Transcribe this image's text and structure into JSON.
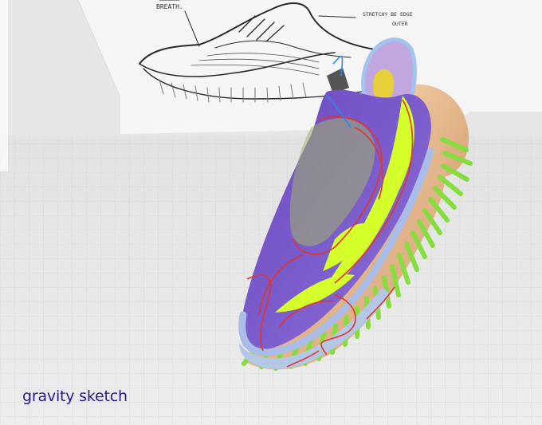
{
  "app": {
    "brand_name": "gravity sketch",
    "brand_color": "#2a1a8c"
  },
  "scene": {
    "background_color": "#e6e6e6",
    "grid_color": "#d2d2d2",
    "sketch_panel_color": "#f5f5f5"
  },
  "sketch_notes": {
    "note_top": "BREATH.",
    "note_right_1": "STRETCHY BE EDGE",
    "note_right_2": "OUTER"
  },
  "model": {
    "upper_color": "#7a57c9",
    "accent_color": "#d4ff2a",
    "sole_color": "#e9c19a",
    "lug_color": "#8ee048",
    "curve_color": "#e0352b",
    "collar_color": "#b49ad8"
  }
}
